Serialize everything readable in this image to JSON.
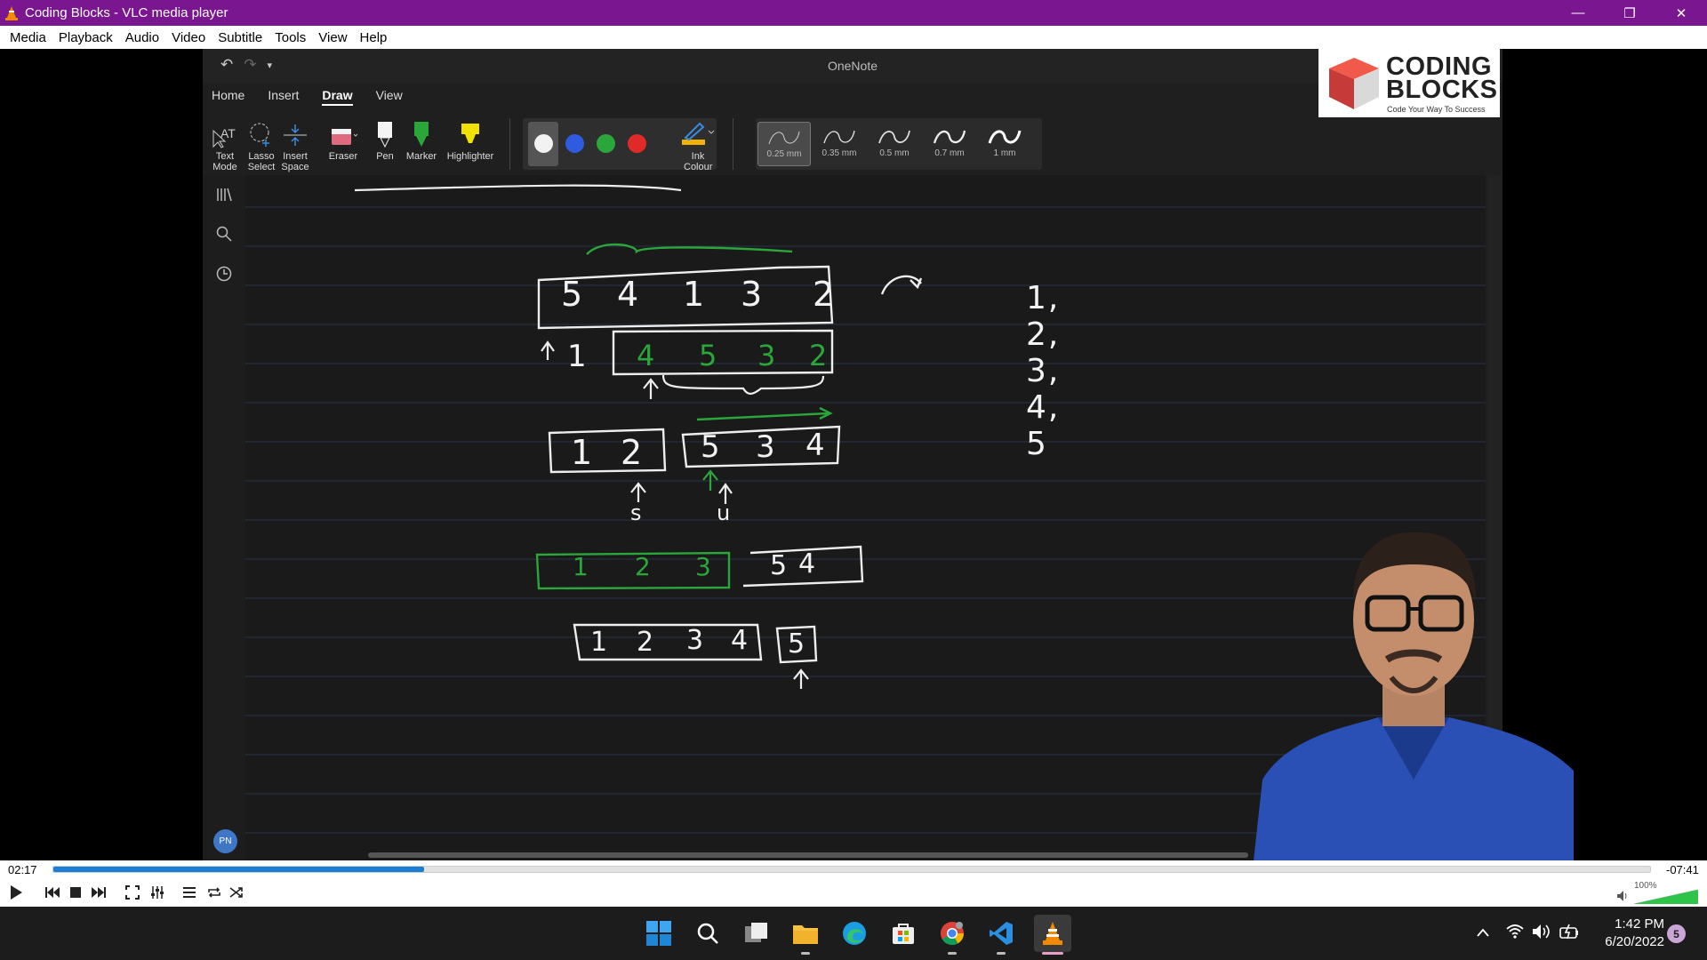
{
  "window": {
    "title": "Coding Blocks - VLC media player",
    "minimize": "—",
    "restore": "❐",
    "close": "✕"
  },
  "menu": [
    "Media",
    "Playback",
    "Audio",
    "Video",
    "Subtitle",
    "Tools",
    "View",
    "Help"
  ],
  "video": {
    "onenote": {
      "app_name": "OneNote",
      "tabs": [
        "Home",
        "Insert",
        "Draw",
        "View"
      ],
      "active_tab": "Draw",
      "tools": {
        "text_mode": "Text Mode",
        "lasso_select": "Lasso Select",
        "insert_space": "Insert Space",
        "eraser": "Eraser",
        "pen": "Pen",
        "marker": "Marker",
        "highlighter": "Highlighter",
        "ink_colour": "Ink Colour"
      },
      "colors": [
        "#f2f2f2",
        "#2f5be0",
        "#2aa63a",
        "#e02a2a"
      ],
      "thickness": [
        "0.25 mm",
        "0.35 mm",
        "0.5 mm",
        "0.7 mm",
        "1 mm"
      ],
      "selected_thickness": "0.25 mm",
      "avatar_initials": "PN",
      "notes": {
        "top_array": [
          "5",
          "4",
          "1",
          "3",
          "2"
        ],
        "sorted_sequence": "1, 2, 3, 4, 5",
        "row2_left": "1",
        "row2_right": [
          "4",
          "5",
          "3",
          "2"
        ],
        "row3_left": [
          "1",
          "2"
        ],
        "row3_right": [
          "5",
          "3",
          "4"
        ],
        "row3_labels": [
          "s",
          "u"
        ],
        "row4_left": [
          "1",
          "2",
          "3"
        ],
        "row4_right": [
          "5",
          "4"
        ],
        "row5_left": [
          "1",
          "2",
          "3",
          "4"
        ],
        "row5_right": "5"
      }
    },
    "logo": {
      "line1": "CODING",
      "line2": "BLOCKS",
      "tagline": "Code Your Way To Success"
    }
  },
  "player": {
    "elapsed": "02:17",
    "remaining": "-07:41",
    "progress": 0.232,
    "volume": "100%",
    "volume_level": 1.0
  },
  "taskbar": {
    "time": "1:42 PM",
    "date": "6/20/2022",
    "notifications": "5",
    "accent": "#0078d4"
  }
}
